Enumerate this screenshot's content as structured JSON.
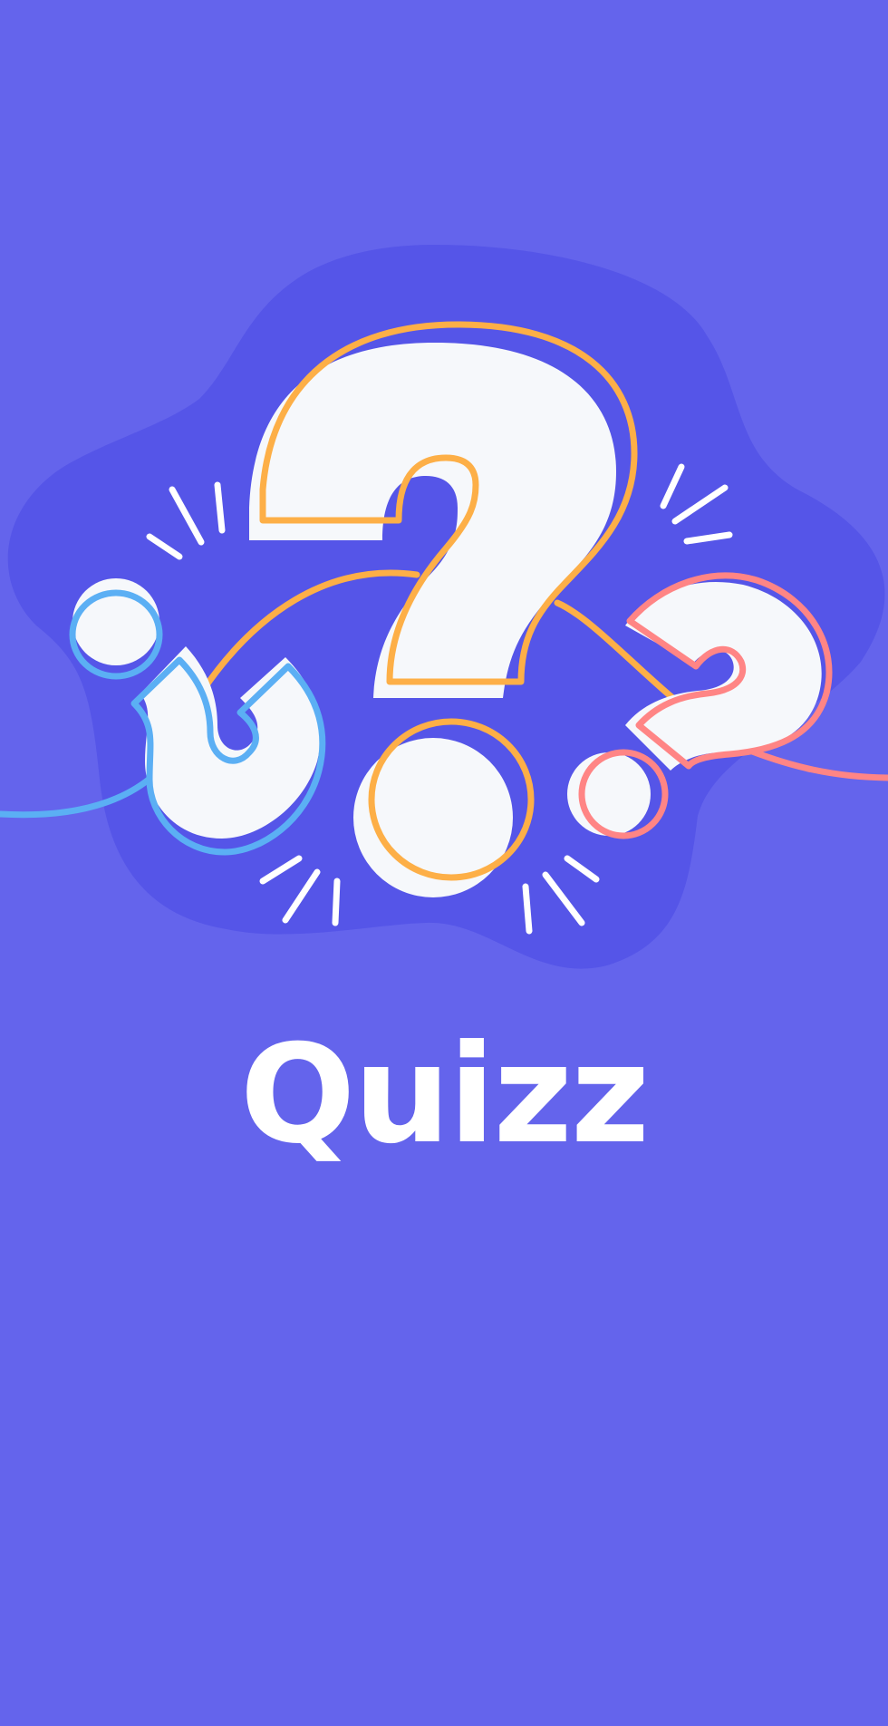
{
  "app": {
    "title": "Quizz"
  },
  "hero": {
    "icon": "question-marks-illustration"
  },
  "colors": {
    "background": "#6464EC",
    "blob": "#5555E8",
    "glyph_fill": "#F6F8FB",
    "accent_orange": "#FDAF47",
    "accent_blue": "#5BAFF4",
    "accent_coral": "#FF8585",
    "text": "#FFFFFF"
  }
}
